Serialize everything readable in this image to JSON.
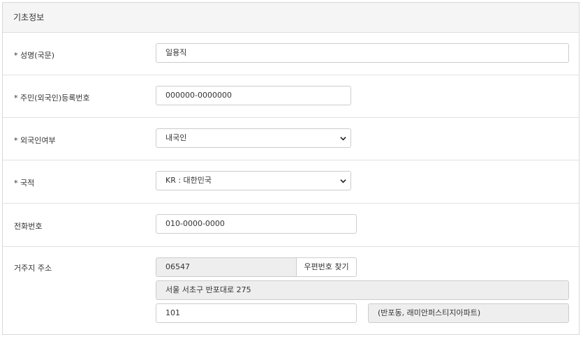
{
  "panel": {
    "title": "기초정보"
  },
  "name": {
    "label": "* 성명(국문)",
    "value": "일용직"
  },
  "resident_number": {
    "label": "* 주민(외국인)등록번호",
    "value": "000000-0000000"
  },
  "foreigner": {
    "label": "* 외국인여부",
    "selected": "내국인"
  },
  "nationality": {
    "label": "* 국적",
    "selected": "KR : 대한민국"
  },
  "phone": {
    "label": "전화번호",
    "value": "010-0000-0000"
  },
  "address": {
    "label": "거주지 주소",
    "postal_code": "06547",
    "find_postal_button": "우편번호 찾기",
    "road_address": "서울 서초구 반포대로 275",
    "detail": "101",
    "extra": "(반포동, 래미안퍼스티지아파트)"
  }
}
